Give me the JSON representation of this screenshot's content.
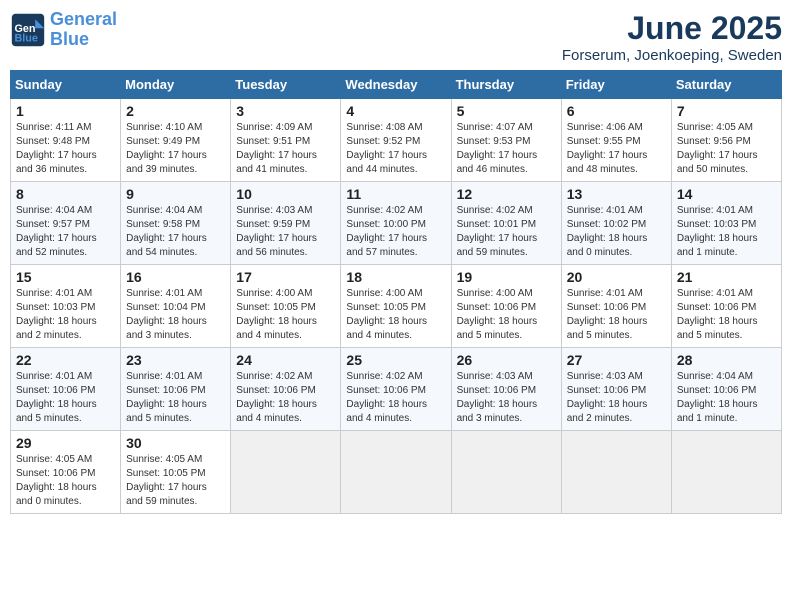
{
  "logo": {
    "line1": "General",
    "line2": "Blue"
  },
  "title": "June 2025",
  "subtitle": "Forserum, Joenkoeping, Sweden",
  "weekdays": [
    "Sunday",
    "Monday",
    "Tuesday",
    "Wednesday",
    "Thursday",
    "Friday",
    "Saturday"
  ],
  "weeks": [
    [
      {
        "day": 1,
        "info": "Sunrise: 4:11 AM\nSunset: 9:48 PM\nDaylight: 17 hours\nand 36 minutes."
      },
      {
        "day": 2,
        "info": "Sunrise: 4:10 AM\nSunset: 9:49 PM\nDaylight: 17 hours\nand 39 minutes."
      },
      {
        "day": 3,
        "info": "Sunrise: 4:09 AM\nSunset: 9:51 PM\nDaylight: 17 hours\nand 41 minutes."
      },
      {
        "day": 4,
        "info": "Sunrise: 4:08 AM\nSunset: 9:52 PM\nDaylight: 17 hours\nand 44 minutes."
      },
      {
        "day": 5,
        "info": "Sunrise: 4:07 AM\nSunset: 9:53 PM\nDaylight: 17 hours\nand 46 minutes."
      },
      {
        "day": 6,
        "info": "Sunrise: 4:06 AM\nSunset: 9:55 PM\nDaylight: 17 hours\nand 48 minutes."
      },
      {
        "day": 7,
        "info": "Sunrise: 4:05 AM\nSunset: 9:56 PM\nDaylight: 17 hours\nand 50 minutes."
      }
    ],
    [
      {
        "day": 8,
        "info": "Sunrise: 4:04 AM\nSunset: 9:57 PM\nDaylight: 17 hours\nand 52 minutes."
      },
      {
        "day": 9,
        "info": "Sunrise: 4:04 AM\nSunset: 9:58 PM\nDaylight: 17 hours\nand 54 minutes."
      },
      {
        "day": 10,
        "info": "Sunrise: 4:03 AM\nSunset: 9:59 PM\nDaylight: 17 hours\nand 56 minutes."
      },
      {
        "day": 11,
        "info": "Sunrise: 4:02 AM\nSunset: 10:00 PM\nDaylight: 17 hours\nand 57 minutes."
      },
      {
        "day": 12,
        "info": "Sunrise: 4:02 AM\nSunset: 10:01 PM\nDaylight: 17 hours\nand 59 minutes."
      },
      {
        "day": 13,
        "info": "Sunrise: 4:01 AM\nSunset: 10:02 PM\nDaylight: 18 hours\nand 0 minutes."
      },
      {
        "day": 14,
        "info": "Sunrise: 4:01 AM\nSunset: 10:03 PM\nDaylight: 18 hours\nand 1 minute."
      }
    ],
    [
      {
        "day": 15,
        "info": "Sunrise: 4:01 AM\nSunset: 10:03 PM\nDaylight: 18 hours\nand 2 minutes."
      },
      {
        "day": 16,
        "info": "Sunrise: 4:01 AM\nSunset: 10:04 PM\nDaylight: 18 hours\nand 3 minutes."
      },
      {
        "day": 17,
        "info": "Sunrise: 4:00 AM\nSunset: 10:05 PM\nDaylight: 18 hours\nand 4 minutes."
      },
      {
        "day": 18,
        "info": "Sunrise: 4:00 AM\nSunset: 10:05 PM\nDaylight: 18 hours\nand 4 minutes."
      },
      {
        "day": 19,
        "info": "Sunrise: 4:00 AM\nSunset: 10:06 PM\nDaylight: 18 hours\nand 5 minutes."
      },
      {
        "day": 20,
        "info": "Sunrise: 4:01 AM\nSunset: 10:06 PM\nDaylight: 18 hours\nand 5 minutes."
      },
      {
        "day": 21,
        "info": "Sunrise: 4:01 AM\nSunset: 10:06 PM\nDaylight: 18 hours\nand 5 minutes."
      }
    ],
    [
      {
        "day": 22,
        "info": "Sunrise: 4:01 AM\nSunset: 10:06 PM\nDaylight: 18 hours\nand 5 minutes."
      },
      {
        "day": 23,
        "info": "Sunrise: 4:01 AM\nSunset: 10:06 PM\nDaylight: 18 hours\nand 5 minutes."
      },
      {
        "day": 24,
        "info": "Sunrise: 4:02 AM\nSunset: 10:06 PM\nDaylight: 18 hours\nand 4 minutes."
      },
      {
        "day": 25,
        "info": "Sunrise: 4:02 AM\nSunset: 10:06 PM\nDaylight: 18 hours\nand 4 minutes."
      },
      {
        "day": 26,
        "info": "Sunrise: 4:03 AM\nSunset: 10:06 PM\nDaylight: 18 hours\nand 3 minutes."
      },
      {
        "day": 27,
        "info": "Sunrise: 4:03 AM\nSunset: 10:06 PM\nDaylight: 18 hours\nand 2 minutes."
      },
      {
        "day": 28,
        "info": "Sunrise: 4:04 AM\nSunset: 10:06 PM\nDaylight: 18 hours\nand 1 minute."
      }
    ],
    [
      {
        "day": 29,
        "info": "Sunrise: 4:05 AM\nSunset: 10:06 PM\nDaylight: 18 hours\nand 0 minutes."
      },
      {
        "day": 30,
        "info": "Sunrise: 4:05 AM\nSunset: 10:05 PM\nDaylight: 17 hours\nand 59 minutes."
      },
      null,
      null,
      null,
      null,
      null
    ]
  ]
}
